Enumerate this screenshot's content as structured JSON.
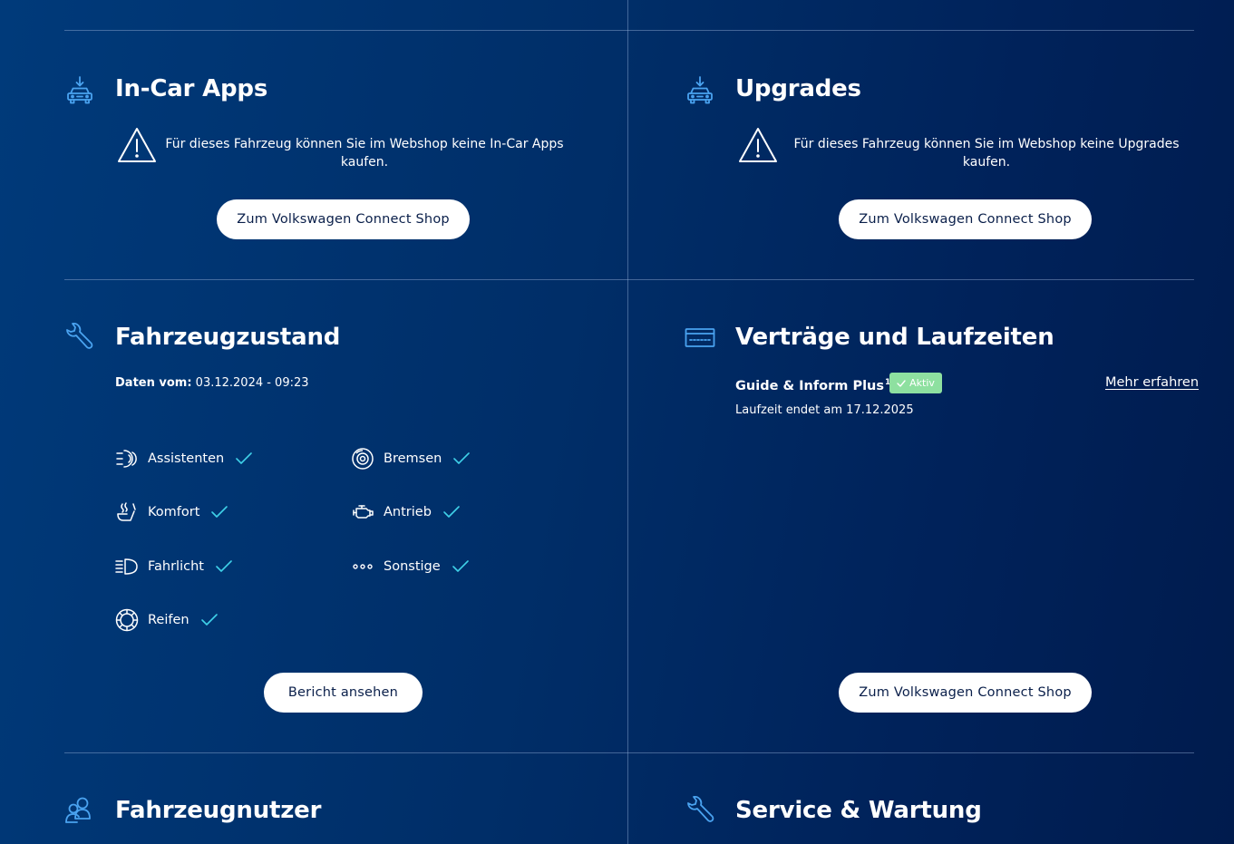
{
  "tiles": {
    "in_car_apps": {
      "title": "In-Car Apps",
      "notice": "Für dieses Fahrzeug können Sie im Webshop keine In-Car Apps kaufen.",
      "button": "Zum Volkswagen Connect Shop",
      "icon": "car-download-icon"
    },
    "upgrades": {
      "title": "Upgrades",
      "notice": "Für dieses Fahrzeug können Sie im Webshop keine Upgrades kaufen.",
      "button": "Zum Volkswagen Connect Shop",
      "icon": "car-download-icon"
    },
    "vehicle_status": {
      "title": "Fahrzeugzustand",
      "date_label": "Daten vom:",
      "date_value": "03.12.2024 - 09:23",
      "items": [
        {
          "label": "Assistenten",
          "icon": "assist-icon",
          "ok": true
        },
        {
          "label": "Bremsen",
          "icon": "brake-icon",
          "ok": true
        },
        {
          "label": "Komfort",
          "icon": "seat-heat-icon",
          "ok": true
        },
        {
          "label": "Antrieb",
          "icon": "engine-icon",
          "ok": true
        },
        {
          "label": "Fahrlicht",
          "icon": "headlight-icon",
          "ok": true
        },
        {
          "label": "Sonstige",
          "icon": "more-dots-icon",
          "ok": true
        },
        {
          "label": "Reifen",
          "icon": "tire-icon",
          "ok": true
        }
      ],
      "button": "Bericht ansehen",
      "icon": "wrench-icon"
    },
    "contracts": {
      "title": "Verträge und Laufzeiten",
      "contract_name": "Guide & Inform Plus",
      "footnote": "1",
      "badge": "Aktiv",
      "more_link": "Mehr erfahren",
      "runtime": "Laufzeit endet am 17.12.2025",
      "button": "Zum Volkswagen Connect Shop",
      "icon": "contract-card-icon"
    },
    "users": {
      "title": "Fahrzeugnutzer",
      "icon": "users-icon"
    },
    "service": {
      "title": "Service & Wartung",
      "icon": "wrench-icon"
    }
  },
  "colors": {
    "accent_icon": "#4aa3f0",
    "check": "#3fd1e8",
    "badge": "#8ee0a0",
    "button_bg": "#ffffff",
    "button_text": "#0a1f4a"
  }
}
